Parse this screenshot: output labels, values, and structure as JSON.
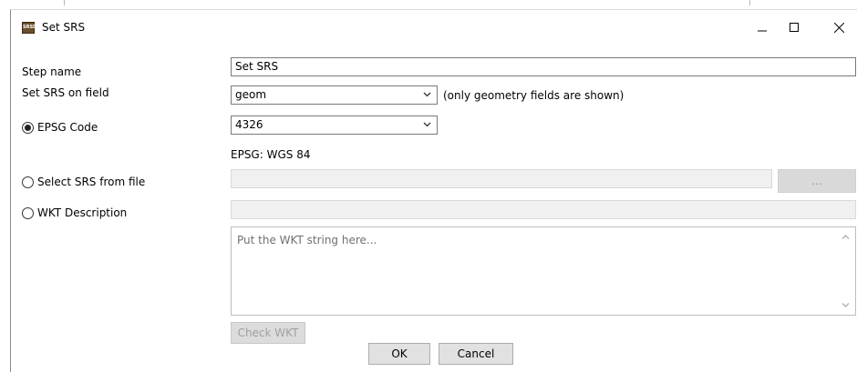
{
  "window": {
    "title": "Set SRS",
    "icon": "srs-app-icon",
    "icon_text": "SRSD",
    "controls": [
      "minimize-icon",
      "maximize-icon",
      "close-icon"
    ]
  },
  "form": {
    "step_name": {
      "label": "Step name",
      "value": "Set SRS"
    },
    "srs_field": {
      "label": "Set SRS on field",
      "value": "geom",
      "note": "(only geometry fields are shown)"
    },
    "epsg": {
      "label": "EPSG Code",
      "selected": true,
      "value": "4326",
      "description": "EPSG: WGS 84"
    },
    "file": {
      "label": "Select SRS from file",
      "selected": false,
      "value": "",
      "browse_label": "..."
    },
    "wkt": {
      "label": "WKT Description",
      "selected": false,
      "value": "",
      "placeholder": "Put the WKT string here...",
      "check_label": "Check WKT"
    }
  },
  "footer": {
    "ok_label": "OK",
    "cancel_label": "Cancel"
  }
}
